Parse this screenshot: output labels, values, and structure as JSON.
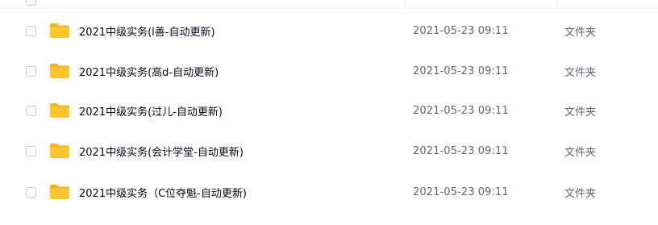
{
  "colors": {
    "folder": "#ffc531",
    "folder_tab": "#ffaf1d",
    "name_text": "#03081a",
    "meta_text": "#5e6779",
    "checkbox_border": "#c5cad3"
  },
  "files": [
    {
      "name": "2021中级实务(l善-自动更新)",
      "modified": "2021-05-23 09:11",
      "type": "文件夹",
      "icon": "folder-icon"
    },
    {
      "name": "2021中级实务(高d-自动更新)",
      "modified": "2021-05-23 09:11",
      "type": "文件夹",
      "icon": "folder-icon"
    },
    {
      "name": "2021中级实务(过儿-自动更新)",
      "modified": "2021-05-23 09:11",
      "type": "文件夹",
      "icon": "folder-icon"
    },
    {
      "name": "2021中级实务(会计学堂-自动更新)",
      "modified": "2021-05-23 09:11",
      "type": "文件夹",
      "icon": "folder-icon"
    },
    {
      "name": "2021中级实务（C位夺魁-自动更新)",
      "modified": "2021-05-23 09:11",
      "type": "文件夹",
      "icon": "folder-icon"
    }
  ]
}
